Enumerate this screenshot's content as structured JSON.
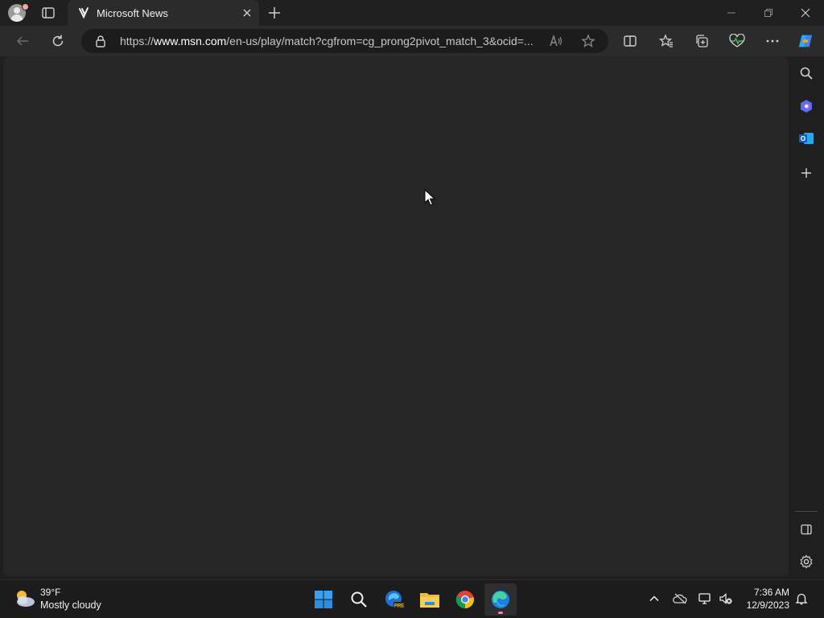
{
  "browser": {
    "tab": {
      "title": "Microsoft News"
    },
    "address": {
      "prefix": "https://",
      "host": "www.msn.com",
      "path": "/en-us/play/match?cgfrom=cg_prong2pivot_match_3&ocid=..."
    },
    "window_controls": [
      "minimize-icon",
      "restore-icon",
      "close-icon"
    ],
    "toolbar_icons": [
      "split-screen-icon",
      "favorites-icon",
      "collections-icon",
      "browser-essentials-icon",
      "more-icon",
      "copilot-icon"
    ],
    "sidebar_icons": [
      "search-icon",
      "copilot-discover-icon",
      "outlook-icon",
      "add-icon",
      "hide-sidebar-icon",
      "settings-icon"
    ]
  },
  "taskbar": {
    "weather": {
      "temp": "39°F",
      "desc": "Mostly cloudy"
    },
    "apps": [
      "start-icon",
      "search-icon",
      "edge-preview-icon",
      "file-explorer-icon",
      "chrome-icon",
      "edge-icon"
    ],
    "clock": {
      "time": "7:36 AM",
      "date": "12/9/2023"
    }
  },
  "colors": {
    "accent": "#0078d4",
    "page_background": "#262626",
    "chrome_background": "#202020"
  }
}
